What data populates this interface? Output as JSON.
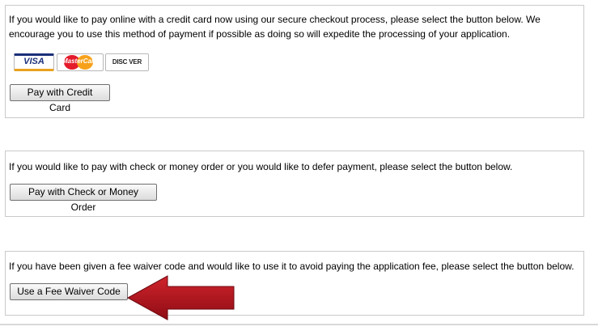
{
  "credit_card": {
    "text": "If you would like to pay online with a credit card now using our secure checkout process, please select the button below. We encourage you to use this method of payment if possible as doing so will expedite the processing of your application.",
    "button": "Pay with Credit Card",
    "cards": {
      "visa": "VISA",
      "mastercard": "MasterCard",
      "discover": "DISC VER"
    }
  },
  "check": {
    "text": "If you would like to pay with check or money order or you would like to defer payment, please select the button below.",
    "button": "Pay with Check or Money Order"
  },
  "waiver": {
    "text": "If you have been given a fee waiver code and would like to use it to avoid paying the application fee, please select the button below.",
    "button": "Use a Fee Waiver Code"
  },
  "colors": {
    "arrow": "#b5121b",
    "visa_blue": "#1a2f7a",
    "mastercard_red": "#e41b2b",
    "mastercard_orange": "#f7a11a",
    "discover_orange": "#f26f21"
  },
  "icons": [
    "visa-logo-icon",
    "mastercard-logo-icon",
    "discover-logo-icon",
    "red-arrow-icon"
  ]
}
